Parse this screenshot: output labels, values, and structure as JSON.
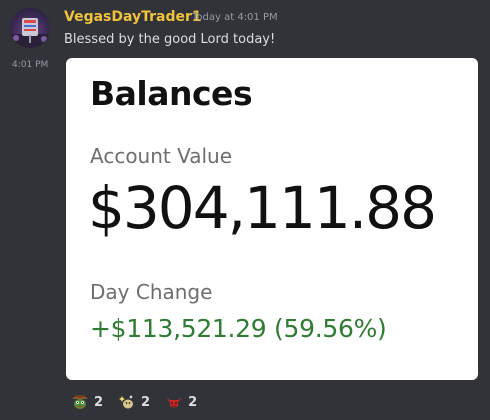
{
  "message": {
    "author": "VegasDayTrader1",
    "timestamp": "Today at 4:01 PM",
    "text": "Blessed by the good Lord today!",
    "side_time": "4:01 PM",
    "avatar_icon": "vegas-sign-avatar"
  },
  "card": {
    "title": "Balances",
    "account_label": "Account Value",
    "account_value": "$304,111.88",
    "day_change_label": "Day Change",
    "day_change_value": "+$113,521.29 (59.56%)",
    "positive_color": "#2e7d32"
  },
  "reactions": [
    {
      "icon": "frog-cowboy-emoji-icon",
      "count": "2"
    },
    {
      "icon": "sparkle-doge-emoji-icon",
      "count": "2"
    },
    {
      "icon": "red-bull-emoji-icon",
      "count": "2"
    }
  ],
  "colors": {
    "background": "#313338",
    "username": "#f0c33c",
    "muted": "#949ba4",
    "text": "#dbdee1"
  }
}
